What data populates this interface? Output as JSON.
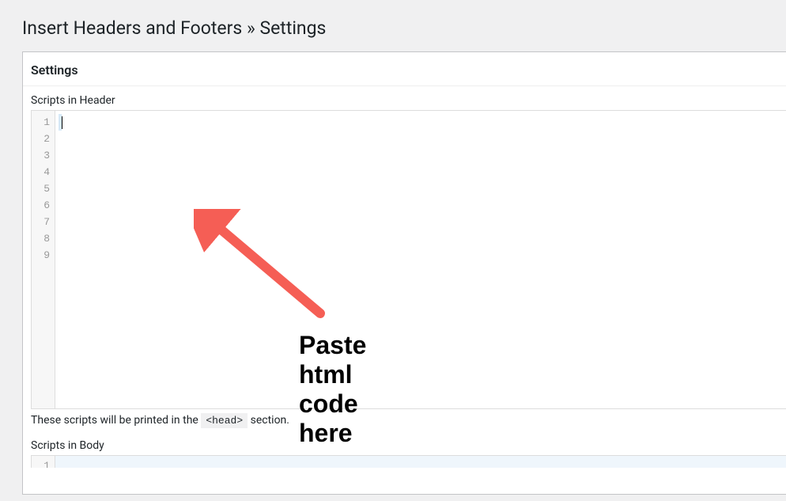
{
  "page": {
    "title": "Insert Headers and Footers » Settings"
  },
  "panel": {
    "heading": "Settings"
  },
  "header_section": {
    "label": "Scripts in Header",
    "line_numbers": [
      "1",
      "2",
      "3",
      "4",
      "5",
      "6",
      "7",
      "8",
      "9"
    ],
    "help_prefix": "These scripts will be printed in the ",
    "help_code": "<head>",
    "help_suffix": " section."
  },
  "body_section": {
    "label": "Scripts in Body",
    "line_numbers": [
      "1"
    ]
  },
  "annotation": {
    "text": "Paste html code here",
    "color": "#f55e55"
  }
}
